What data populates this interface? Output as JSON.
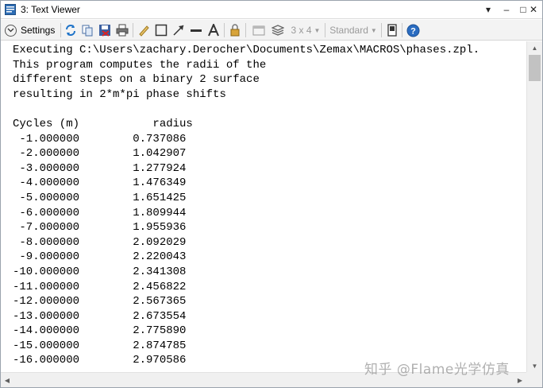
{
  "window": {
    "title": "3: Text Viewer",
    "controls": {
      "dropdown": "▾",
      "minimize": "–",
      "maximize": "□",
      "close": "✕"
    }
  },
  "toolbar": {
    "settings_label": "Settings",
    "layout_combo": "3 x 4",
    "style_combo": "Standard",
    "icons": [
      "refresh-icon",
      "copy-icon",
      "save-icon",
      "print-icon",
      "pencil-icon",
      "rectangle-icon",
      "arrow-icon",
      "line-icon",
      "text-icon",
      "lock-icon",
      "window-icon",
      "layers-icon",
      "layout-combo",
      "style-combo",
      "fullscreen-icon",
      "help-icon"
    ]
  },
  "text": {
    "lines": [
      "Executing C:\\Users\\zachary.Derocher\\Documents\\Zemax\\MACROS\\phases.zpl.",
      "This program computes the radii of the",
      "different steps on a binary 2 surface",
      "resulting in 2*m*pi phase shifts",
      "",
      "Cycles (m)           radius",
      " -1.000000        0.737086",
      " -2.000000        1.042907",
      " -3.000000        1.277924",
      " -4.000000        1.476349",
      " -5.000000        1.651425",
      " -6.000000        1.809944",
      " -7.000000        1.955936",
      " -8.000000        2.092029",
      " -9.000000        2.220043",
      "-10.000000        2.341308",
      "-11.000000        2.456822",
      "-12.000000        2.567365",
      "-13.000000        2.673554",
      "-14.000000        2.775890",
      "-15.000000        2.874785",
      "-16.000000        2.970586"
    ]
  },
  "scrollbars": {
    "up": "▲",
    "down": "▼",
    "left": "◀",
    "right": "▶"
  },
  "watermark": "知乎 @Flame光学仿真"
}
